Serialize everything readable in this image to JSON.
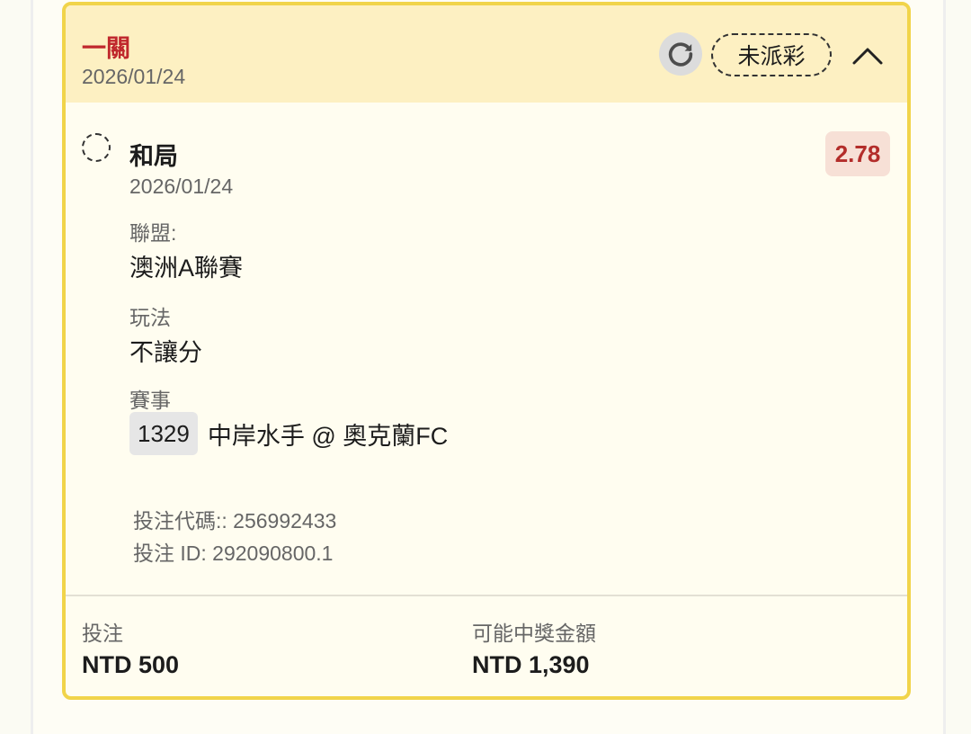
{
  "bet_card": {
    "header": {
      "title": "一關",
      "date": "2026/01/24",
      "status_badge": "未派彩",
      "refresh_icon": "refresh-icon",
      "collapse_icon": "chevron-up-icon"
    },
    "selection": {
      "name": "和局",
      "date": "2026/01/24",
      "odds": "2.78",
      "league_label": "聯盟:",
      "league_value": "澳洲A聯賽",
      "play_label": "玩法",
      "play_value": "不讓分",
      "match_label": "賽事",
      "match_id": "1329",
      "match_name": "中岸水手 @ 奧克蘭FC"
    },
    "bet_code": "投注代碼:: 256992433",
    "bet_id": "投注 ID: 292090800.1",
    "footer": {
      "stake_label": "投注",
      "stake_value": "NTD 500",
      "payout_label": "可能中獎金額",
      "payout_value": "NTD 1,390"
    }
  },
  "colors": {
    "accent_red": "#c0282d",
    "header_bg": "#fdf0c2",
    "card_border": "#f1d44a",
    "odds_bg": "#f7e0d6"
  }
}
